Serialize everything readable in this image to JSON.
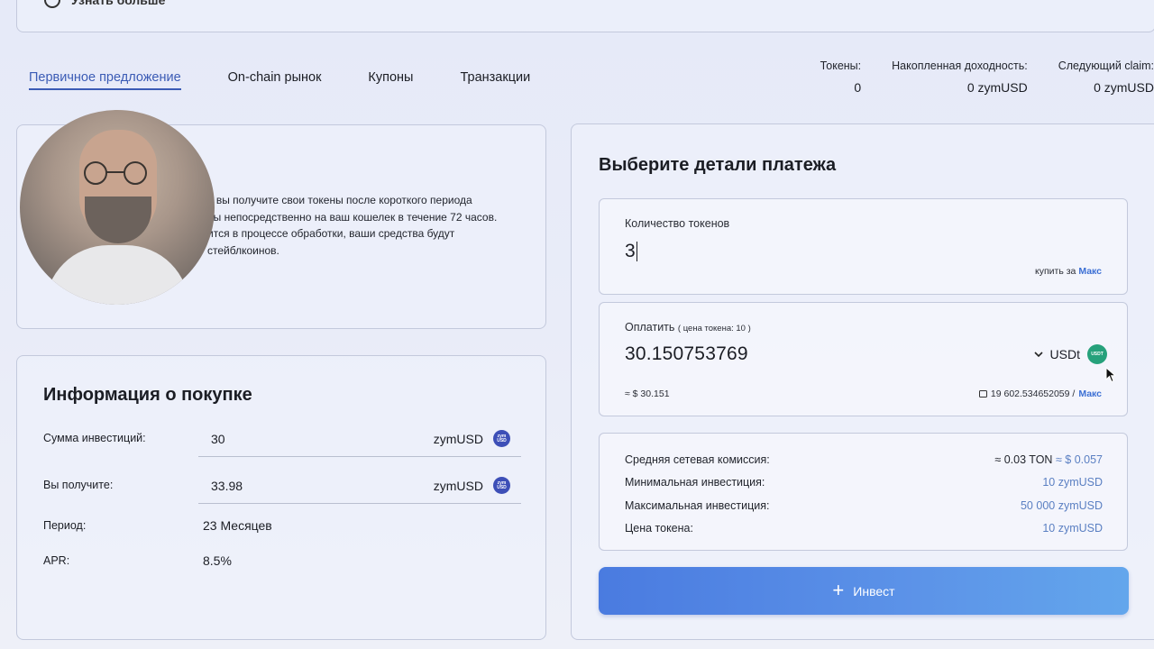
{
  "top": {
    "more_label": "Узнать больше"
  },
  "tabs": [
    {
      "label": "Первичное предложение",
      "active": true
    },
    {
      "label": "On-chain рынок"
    },
    {
      "label": "Купоны"
    },
    {
      "label": "Транзакции"
    }
  ],
  "stats": [
    {
      "label": "Токены:",
      "value": "0"
    },
    {
      "label": "Накопленная доходность:",
      "value": "0 zymUSD"
    },
    {
      "label": "Следующий claim:",
      "value": "0 zymUSD"
    }
  ],
  "info": {
    "lines": [
      "п вы получите свои токены после короткого периода",
      "ны непосредственно на ваш кошелек в течение 72 часов.",
      "ится в процессе обработки, ваши средства будут",
      "стейблкоинов."
    ]
  },
  "purchase": {
    "title": "Информация о покупке",
    "rows": [
      {
        "label": "Сумма инвестиций:",
        "value": "30",
        "unit": "zymUSD",
        "coin": "zym USD"
      },
      {
        "label": "Вы получите:",
        "value": "33.98",
        "unit": "zymUSD",
        "coin": "zym USD"
      },
      {
        "label": "Период:",
        "value": "23 Месяцев"
      },
      {
        "label": "APR:",
        "value": "8.5%"
      }
    ]
  },
  "payment": {
    "title": "Выберите детали платежа",
    "qty_label": "Количество токенов",
    "qty_value": "3",
    "buy_for": "купить за",
    "max": "Макс",
    "pay_label": "Оплатить",
    "pay_note": "( цена токена: 10 )",
    "pay_amount": "30.150753769",
    "currency": "USDt",
    "currency_badge": "USDT",
    "approx": "≈ $ 30.151",
    "balance": "19 602.534652059 /",
    "fees": [
      {
        "label": "Средняя сетевая комиссия:",
        "value_dark": "≈ 0.03 TON",
        "value": "≈ $ 0.057"
      },
      {
        "label": "Минимальная инвестиция:",
        "value": "10 zymUSD"
      },
      {
        "label": "Максимальная инвестиция:",
        "value": "50 000 zymUSD"
      },
      {
        "label": "Цена токена:",
        "value": "10 zymUSD"
      }
    ],
    "invest_label": "Инвест"
  },
  "colors": {
    "accent": "#3b5bb5",
    "link": "#3b6fd4",
    "button": "#4a7be0",
    "usdt": "#26a17b",
    "zym": "#3d4fb7"
  }
}
